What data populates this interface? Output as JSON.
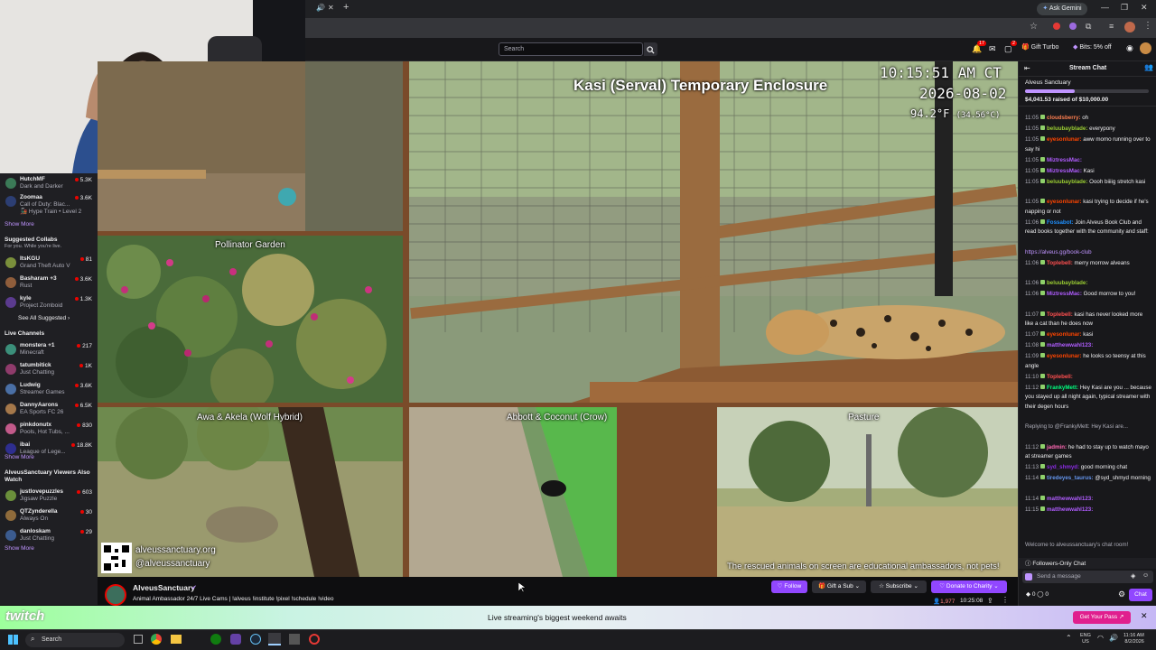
{
  "browser": {
    "gemini_label": "Ask Gemini",
    "controls": [
      "—",
      "❐",
      "✕"
    ]
  },
  "twitch_header": {
    "search_placeholder": "Search",
    "notif_count": "17",
    "whisper_count": "2",
    "gift_turbo": "Gift Turbo",
    "bits": "Bits: 5% off"
  },
  "sidebar": {
    "channels_top": [
      {
        "name": "HutchMF",
        "game": "Dark and Darker",
        "viewers": "5.3K"
      },
      {
        "name": "Zoomaa",
        "game": "Call of Duty: Blac...",
        "extra": "Hype Train • Level 2",
        "viewers": "3.6K"
      }
    ],
    "show_more": "Show More",
    "suggested_collabs": "Suggested Collabs",
    "suggested_sub": "For you. While you're live.",
    "collabs": [
      {
        "name": "ItsKGU",
        "game": "Grand Theft Auto V",
        "viewers": "81"
      },
      {
        "name": "Basharam +3",
        "game": "Rust",
        "viewers": "3.6K"
      },
      {
        "name": "kyle",
        "game": "Project Zomboid",
        "viewers": "1.3K"
      }
    ],
    "see_all": "See All Suggested",
    "live_channels": "Live Channels",
    "live": [
      {
        "name": "monstera +1",
        "game": "Minecraft",
        "viewers": "217"
      },
      {
        "name": "tatumbitick",
        "game": "Just Chatting",
        "viewers": "1K"
      },
      {
        "name": "Ludwig",
        "game": "Streamer Games",
        "viewers": "3.6K"
      },
      {
        "name": "DannyAarons",
        "game": "EA Sports FC 26",
        "viewers": "6.5K"
      },
      {
        "name": "pinkdonutx",
        "game": "Pools, Hot Tubs, ...",
        "viewers": "830"
      },
      {
        "name": "ibai",
        "game": "League of Lege...",
        "viewers": "18.8K"
      }
    ],
    "also_watch": "AlveusSanctuary Viewers Also Watch",
    "also": [
      {
        "name": "justlovepuzzles",
        "game": "Jigsaw Puzzle",
        "viewers": "603"
      },
      {
        "name": "QTZynderella",
        "game": "Always On",
        "viewers": "30"
      },
      {
        "name": "danloskam",
        "game": "Just Chatting",
        "viewers": "29"
      }
    ]
  },
  "stream": {
    "main_title": "Kasi (Serval) Temporary Enclosure",
    "time": "10:15:51 AM CT",
    "date": "2026-08-02",
    "temp": "94.2°F",
    "temp_c": "(34.56°C)",
    "cam_labels": {
      "pollinator": "Pollinator Garden",
      "wolf": "Awa & Akela (Wolf Hybrid)",
      "crow": "Abbott & Coconut (Crow)",
      "pasture": "Pasture"
    },
    "website": "alveussanctuary.org",
    "handle": "@alveussanctuary",
    "disclaimer": "The rescued animals on screen are educational ambassadors, not pets!"
  },
  "info": {
    "channel": "AlveusSanctuary",
    "title": "Animal Ambassador 24/7 Live Cams | !alveus !institute !pixel !schedule !video",
    "follow": "Follow",
    "gift_sub": "Gift a Sub",
    "subscribe": "Subscribe",
    "donate": "Donate to Charity",
    "viewers": "1,977",
    "uptime": "10:25:08"
  },
  "chat": {
    "header": "Stream Chat",
    "goal_name": "Alveus Sanctuary",
    "goal_raised": "$4,041.53 raised of $10,000.00",
    "goal_fraction": 0.404,
    "messages": [
      {
        "time": "11:05",
        "user": "cloudsberry:",
        "color": "#ff7f50",
        "text": " oh"
      },
      {
        "time": "11:05",
        "user": "beluubayblade:",
        "color": "#9acd32",
        "text": " everypony"
      },
      {
        "time": "11:05",
        "user": "eyesonlunar:",
        "color": "#ff4500",
        "text": " aww momo running over to say hi"
      },
      {
        "time": "11:05",
        "user": "MiztressMac:",
        "color": "#b05cff",
        "text": ""
      },
      {
        "time": "11:05",
        "user": "MiztressMac:",
        "color": "#b05cff",
        "text": " Kasi"
      },
      {
        "time": "11:05",
        "user": "beluubayblade:",
        "color": "#9acd32",
        "text": " Oooh biiiig stretch kasi"
      },
      {
        "time": "11:05",
        "user": "eyesonlunar:",
        "color": "#ff4500",
        "text": " kasi trying to decide if he's napping or not"
      },
      {
        "time": "11:06",
        "user": "Fossabot:",
        "color": "#1e90ff",
        "text": " Join Alveus Book Club and read books together with the community and staff:"
      },
      {
        "time": "",
        "user": "",
        "color": "#bf94ff",
        "text": "https://alveus.gg/book-club"
      },
      {
        "time": "11:06",
        "user": "Toplebell:",
        "color": "#ff4f4f",
        "text": " merry morrow alveans"
      },
      {
        "time": "11:06",
        "user": "beluubayblade:",
        "color": "#9acd32",
        "text": ""
      },
      {
        "time": "11:06",
        "user": "MiztressMac:",
        "color": "#b05cff",
        "text": " Good morrow to you!"
      },
      {
        "time": "11:07",
        "user": "Toplebell:",
        "color": "#ff4f4f",
        "text": " kasi has never looked more like a cat than he does now"
      },
      {
        "time": "11:07",
        "user": "eyesonlunar:",
        "color": "#ff4500",
        "text": " kasi"
      },
      {
        "time": "11:08",
        "user": "matthewwahl123:",
        "color": "#b05cff",
        "text": ""
      },
      {
        "time": "11:09",
        "user": "eyesonlunar:",
        "color": "#ff4500",
        "text": " he looks so teensy at this angle"
      },
      {
        "time": "11:10",
        "user": "Toplebell:",
        "color": "#ff4f4f",
        "text": ""
      },
      {
        "time": "11:12",
        "user": "FrankyMett:",
        "color": "#00ff7f",
        "text": " Hey Kasi are you ... because you stayed up all night again, typical streamer with their degen hours"
      },
      {
        "time": "",
        "user": "",
        "color": "#adadb8",
        "text": "Replying to @FrankyMett: Hey Kasi are..."
      },
      {
        "time": "11:12",
        "user": "jadmin:",
        "color": "#ff69b4",
        "text": " he had to stay up to watch mayo at streamer games"
      },
      {
        "time": "11:13",
        "user": "syd_shmyd:",
        "color": "#8a2be2",
        "text": " good morning chat"
      },
      {
        "time": "11:14",
        "user": "tiredeyes_taurus:",
        "color": "#6495ed",
        "text": " @syd_shmyd morning"
      },
      {
        "time": "11:14",
        "user": "matthewwahl123:",
        "color": "#b05cff",
        "text": ""
      },
      {
        "time": "11:15",
        "user": "matthewwahl123:",
        "color": "#b05cff",
        "text": ""
      }
    ],
    "welcome": "Welcome to alveussanctuary's chat room!",
    "followers_only": "Followers-Only Chat",
    "input_placeholder": "Send a message",
    "points": "0",
    "button": "Chat"
  },
  "promo": {
    "text": "Live streaming's biggest weekend awaits",
    "button": "Get Your Pass ↗"
  },
  "taskbar": {
    "search": "Search",
    "lang": "ENG",
    "region": "US",
    "time": "11:16 AM",
    "date": "8/2/2026"
  }
}
